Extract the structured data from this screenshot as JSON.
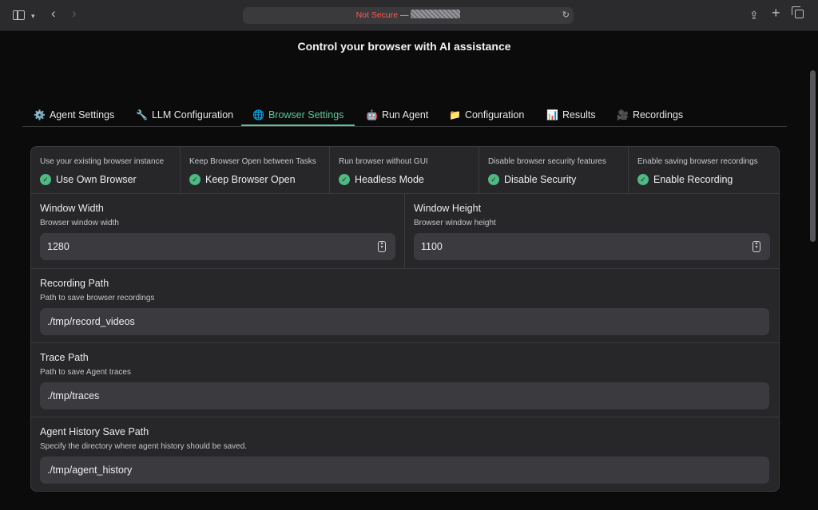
{
  "browser": {
    "not_secure": "Not Secure",
    "url_separator": " — "
  },
  "page": {
    "title": "Control your browser with AI assistance"
  },
  "tabs": [
    {
      "icon": "⚙️",
      "label": "Agent Settings"
    },
    {
      "icon": "🔧",
      "label": "LLM Configuration"
    },
    {
      "icon": "🌐",
      "label": "Browser Settings",
      "active": true
    },
    {
      "icon": "🤖",
      "label": "Run Agent"
    },
    {
      "icon": "📁",
      "label": "Configuration"
    },
    {
      "icon": "📊",
      "label": "Results"
    },
    {
      "icon": "🎥",
      "label": "Recordings"
    }
  ],
  "checkboxes": [
    {
      "info": "Use your existing browser instance",
      "label": "Use Own Browser",
      "checked": true
    },
    {
      "info": "Keep Browser Open between Tasks",
      "label": "Keep Browser Open",
      "checked": true
    },
    {
      "info": "Run browser without GUI",
      "label": "Headless Mode",
      "checked": true
    },
    {
      "info": "Disable browser security features",
      "label": "Disable Security",
      "checked": true
    },
    {
      "info": "Enable saving browser recordings",
      "label": "Enable Recording",
      "checked": true
    }
  ],
  "window_width": {
    "label": "Window Width",
    "info": "Browser window width",
    "value": "1280"
  },
  "window_height": {
    "label": "Window Height",
    "info": "Browser window height",
    "value": "1100"
  },
  "recording_path": {
    "label": "Recording Path",
    "info": "Path to save browser recordings",
    "value": "./tmp/record_videos"
  },
  "trace_path": {
    "label": "Trace Path",
    "info": "Path to save Agent traces",
    "value": "./tmp/traces"
  },
  "history_path": {
    "label": "Agent History Save Path",
    "info": "Specify the directory where agent history should be saved.",
    "value": "./tmp/agent_history"
  },
  "colors": {
    "accent": "#5cc79a",
    "check": "#4fb883",
    "not_secure": "#ff5a4f"
  }
}
